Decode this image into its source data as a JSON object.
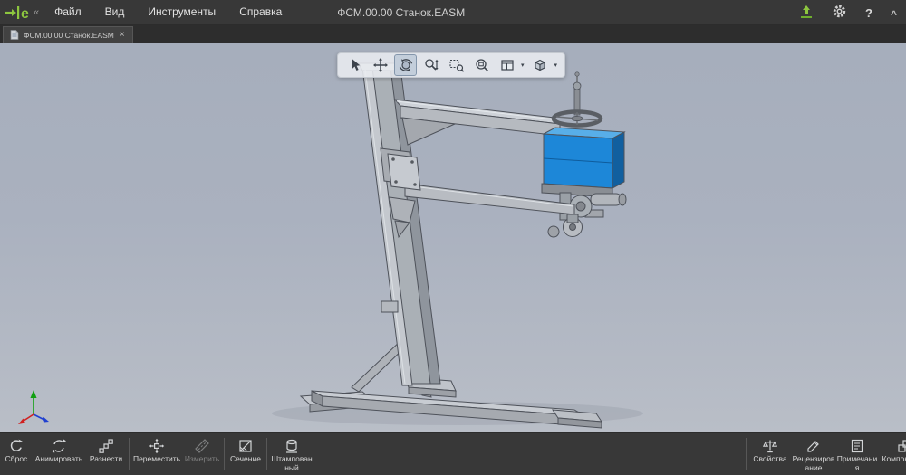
{
  "window": {
    "title": "ФСМ.00.00 Станок.EASM"
  },
  "colors": {
    "topbar_bg": "#383838",
    "accent_green": "#8dc63f",
    "viewport_top": "#a6aebc",
    "viewport_bottom": "#b9bec7",
    "model_blue": "#1d87d8"
  },
  "menubar": {
    "logo_letter": "e",
    "collapse_chevron": "«",
    "items": [
      {
        "label": "Файл"
      },
      {
        "label": "Вид"
      },
      {
        "label": "Инструменты"
      },
      {
        "label": "Справка"
      }
    ],
    "title": "ФСМ.00.00 Станок.EASM",
    "help_label": "?",
    "minimize_label": "^"
  },
  "tabbar": {
    "active_tab": {
      "label": "ФСМ.00.00 Станок.EASM",
      "close_label": "×"
    }
  },
  "view_toolbar": {
    "caret": "▾",
    "tools": [
      {
        "id": "select",
        "icon": "cursor-icon",
        "active": false
      },
      {
        "id": "pan",
        "icon": "pan-icon",
        "active": false
      },
      {
        "id": "rotate",
        "icon": "rotate-icon",
        "active": true
      },
      {
        "id": "zoom-in-out",
        "icon": "zoom-icon",
        "active": false
      },
      {
        "id": "zoom-area",
        "icon": "zoom-area-icon",
        "active": false
      },
      {
        "id": "zoom-fit",
        "icon": "zoom-fit-icon",
        "active": false
      },
      {
        "id": "view-orientation",
        "icon": "views-icon",
        "dropdown": true
      },
      {
        "id": "display-style",
        "icon": "cube-icon",
        "dropdown": true
      }
    ]
  },
  "bottom_toolbar": {
    "left": [
      {
        "label": "Сброс",
        "icon": "reset-icon",
        "enabled": true
      },
      {
        "label": "Анимировать",
        "icon": "animate-icon",
        "enabled": true
      },
      {
        "label": "Разнести",
        "icon": "explode-icon",
        "enabled": true
      },
      {
        "label": "Переместить",
        "icon": "move-icon",
        "enabled": true
      },
      {
        "label": "Измерить",
        "icon": "measure-icon",
        "enabled": false
      },
      {
        "label": "Сечение",
        "icon": "section-icon",
        "enabled": true
      },
      {
        "label": "Штампованный",
        "icon": "stamped-icon",
        "enabled": true
      }
    ],
    "right": [
      {
        "label": "Свойства",
        "icon": "properties-icon"
      },
      {
        "label": "Рецензирование",
        "icon": "review-icon"
      },
      {
        "label": "Примечания",
        "icon": "markup-icon"
      },
      {
        "label": "Компоненты",
        "icon": "components-icon"
      }
    ]
  }
}
